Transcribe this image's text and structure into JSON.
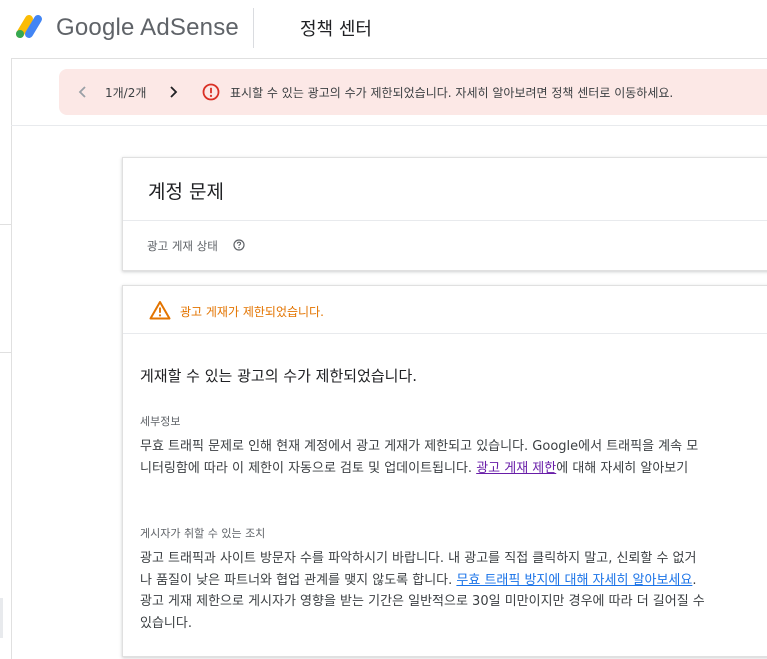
{
  "header": {
    "brand": "Google AdSense",
    "title": "정책 센터"
  },
  "banner": {
    "pager": "1개/2개",
    "message": "표시할 수 있는 광고의 수가 제한되었습니다. 자세히 알아보려면 정책 센터로 이동하세요.",
    "bg_color": "#fce8e6",
    "icon_color": "#d93025"
  },
  "account_card": {
    "title": "계정 문제",
    "status_label": "광고 게재 상태"
  },
  "limit_card": {
    "warning": "광고 게재가 제한되었습니다.",
    "warning_color": "#e37400",
    "headline": "게재할 수 있는 광고의 수가 제한되었습니다.",
    "details_label": "세부정보",
    "details_before": "무효 트래픽 문제로 인해 현재 계정에서 광고 게재가 제한되고 있습니다. Google에서 트래픽을 계속 모니터링함에 따라 이 제한이 자동으로 검토 및 업데이트됩니다. ",
    "details_link": "광고 게재 제한",
    "details_after": "에 대해 자세히 알아보기",
    "actions_label": "게시자가 취할 수 있는 조치",
    "actions_before": "광고 트래픽과 사이트 방문자 수를 파악하시기 바랍니다. 내 광고를 직접 클릭하지 말고, 신뢰할 수 없거나 품질이 낮은 파트너와 협업 관계를 맺지 않도록 합니다. ",
    "actions_link": "무효 트래픽 방지에 대해 자세히 알아보세요",
    "actions_after": ". 광고 게재 제한으로 게시자가 영향을 받는 기간은 일반적으로 30일 미만이지만 경우에 따라 더 길어질 수 있습니다.",
    "link_color": "#1a73e8"
  }
}
